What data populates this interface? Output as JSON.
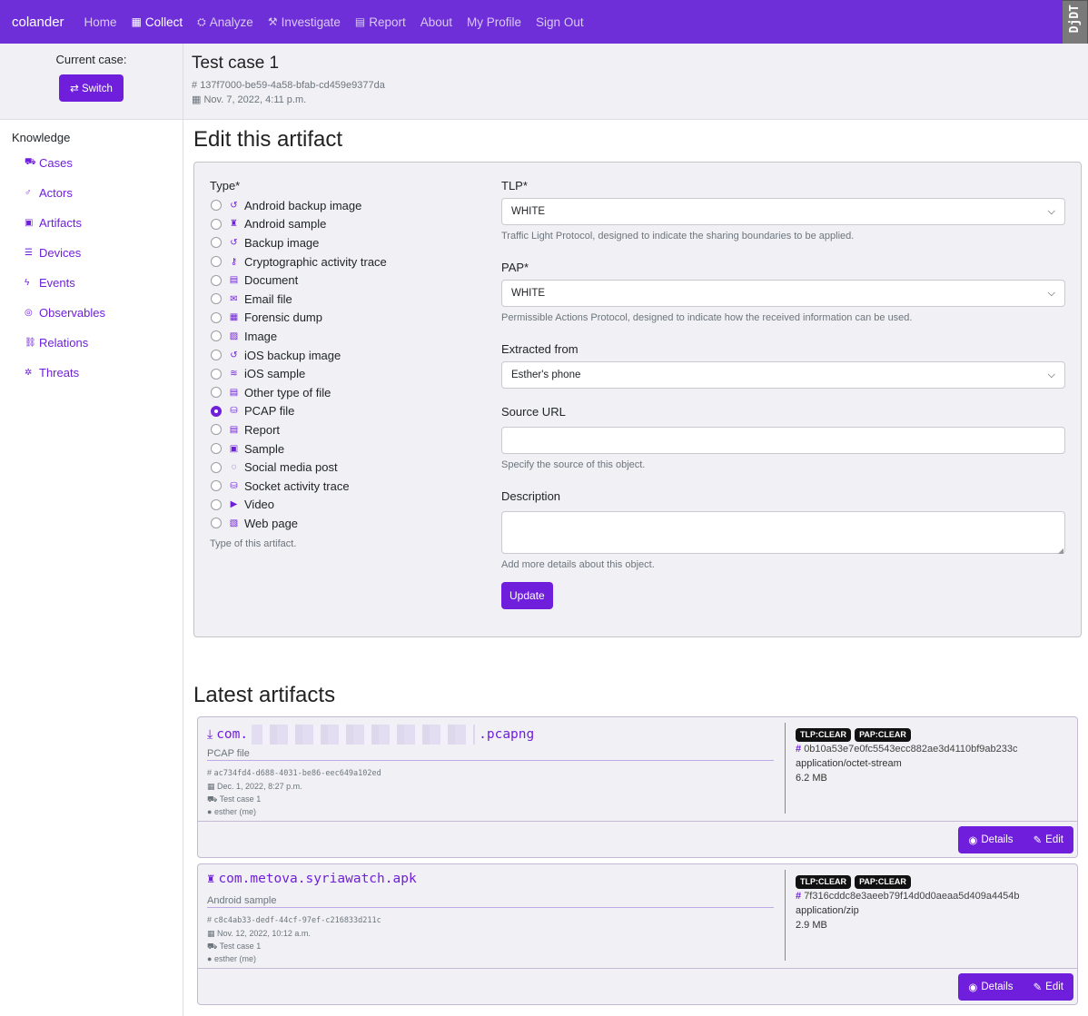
{
  "nav": {
    "brand": "colander",
    "links": [
      {
        "label": "Home",
        "icon": ""
      },
      {
        "label": "Collect",
        "icon": "▦"
      },
      {
        "label": "Analyze",
        "icon": "⛭"
      },
      {
        "label": "Investigate",
        "icon": "⚒"
      },
      {
        "label": "Report",
        "icon": "▤"
      },
      {
        "label": "About",
        "icon": ""
      },
      {
        "label": "My Profile",
        "icon": ""
      },
      {
        "label": "Sign Out",
        "icon": ""
      }
    ],
    "ddt_label": "DjDT"
  },
  "sidebar": {
    "current_case_label": "Current case:",
    "switch_label": "⇄ Switch",
    "knowledge_heading": "Knowledge",
    "items": [
      {
        "label": "Cases",
        "icon": "⛟"
      },
      {
        "label": "Actors",
        "icon": "♂"
      },
      {
        "label": "Artifacts",
        "icon": "▣"
      },
      {
        "label": "Devices",
        "icon": "☰"
      },
      {
        "label": "Events",
        "icon": "ϟ"
      },
      {
        "label": "Observables",
        "icon": "◎"
      },
      {
        "label": "Relations",
        "icon": "⛓"
      },
      {
        "label": "Threats",
        "icon": "✲"
      }
    ]
  },
  "case": {
    "title": "Test case 1",
    "id": "137f7000-be59-4a58-bfab-cd459e9377da",
    "date": "Nov. 7, 2022, 4:11 p.m."
  },
  "form": {
    "heading": "Edit this artifact",
    "type_label": "Type*",
    "types": [
      {
        "label": "Android backup image",
        "icon": "↺",
        "selected": false
      },
      {
        "label": "Android sample",
        "icon": "♜",
        "selected": false
      },
      {
        "label": "Backup image",
        "icon": "↺",
        "selected": false
      },
      {
        "label": "Cryptographic activity trace",
        "icon": "⚷",
        "selected": false
      },
      {
        "label": "Document",
        "icon": "▤",
        "selected": false
      },
      {
        "label": "Email file",
        "icon": "✉",
        "selected": false
      },
      {
        "label": "Forensic dump",
        "icon": "▦",
        "selected": false
      },
      {
        "label": "Image",
        "icon": "▨",
        "selected": false
      },
      {
        "label": "iOS backup image",
        "icon": "↺",
        "selected": false
      },
      {
        "label": "iOS sample",
        "icon": "≋",
        "selected": false
      },
      {
        "label": "Other type of file",
        "icon": "▤",
        "selected": false
      },
      {
        "label": "PCAP file",
        "icon": "⛁",
        "selected": true
      },
      {
        "label": "Report",
        "icon": "▤",
        "selected": false
      },
      {
        "label": "Sample",
        "icon": "▣",
        "selected": false
      },
      {
        "label": "Social media post",
        "icon": "◌",
        "selected": false
      },
      {
        "label": "Socket activity trace",
        "icon": "⛁",
        "selected": false
      },
      {
        "label": "Video",
        "icon": "▶",
        "selected": false
      },
      {
        "label": "Web page",
        "icon": "▧",
        "selected": false
      }
    ],
    "type_help": "Type of this artifact.",
    "tlp_label": "TLP*",
    "tlp_value": "WHITE",
    "tlp_help": "Traffic Light Protocol, designed to indicate the sharing boundaries to be applied.",
    "pap_label": "PAP*",
    "pap_value": "WHITE",
    "pap_help": "Permissible Actions Protocol, designed to indicate how the received information can be used.",
    "extracted_label": "Extracted from",
    "extracted_value": "Esther's phone",
    "source_label": "Source URL",
    "source_value": "",
    "source_help": "Specify the source of this object.",
    "description_label": "Description",
    "description_value": "",
    "description_help": "Add more details about this object.",
    "update_label": "Update"
  },
  "latest": {
    "heading": "Latest artifacts",
    "items": [
      {
        "icon": "⤓",
        "name_prefix": "com.",
        "name_suffix": ".pcapng",
        "redacted": true,
        "type": "PCAP file",
        "id": "ac734fd4-d688-4031-be86-eec649a102ed",
        "date": "Dec. 1, 2022, 8:27 p.m.",
        "case": "Test case 1",
        "owner": "esther (me)",
        "tlp": "TLP:CLEAR",
        "pap": "PAP:CLEAR",
        "sha256": "0b10a53e7e0fc5543ecc882ae3d4110bf9ab233c",
        "mime": "application/octet-stream",
        "size": "6.2 MB",
        "details_label": "Details",
        "edit_label": "Edit"
      },
      {
        "icon": "♜",
        "name_prefix": "com.metova.syriawatch.apk",
        "name_suffix": "",
        "redacted": false,
        "type": "Android sample",
        "id": "c8c4ab33-dedf-44cf-97ef-c216833d211c",
        "date": "Nov. 12, 2022, 10:12 a.m.",
        "case": "Test case 1",
        "owner": "esther (me)",
        "tlp": "TLP:CLEAR",
        "pap": "PAP:CLEAR",
        "sha256": "7f316cddc8e3aeeb79f14d0d0aeaa5d409a4454b",
        "mime": "application/zip",
        "size": "2.9 MB",
        "details_label": "Details",
        "edit_label": "Edit"
      }
    ]
  },
  "colors": {
    "accent": "#6f1fdb",
    "navbar": "#6f2fd8",
    "background": "#f1f0f4"
  }
}
